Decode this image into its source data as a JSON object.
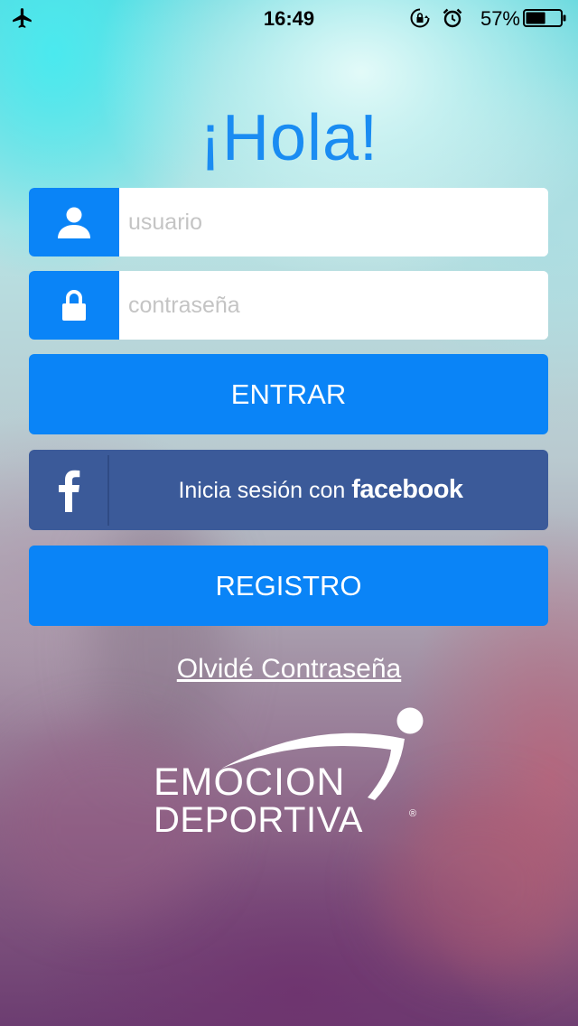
{
  "status_bar": {
    "time": "16:49",
    "battery_percent": "57%",
    "battery_level": 0.57,
    "icons": [
      "airplane-icon",
      "rotation-lock-icon",
      "alarm-icon",
      "battery-icon"
    ]
  },
  "login": {
    "title": "¡Hola!",
    "username": {
      "placeholder": "usuario",
      "value": ""
    },
    "password": {
      "placeholder": "contraseña",
      "value": ""
    },
    "enter_label": "ENTRAR",
    "facebook": {
      "prefix": "Inicia sesión con",
      "brand": "facebook"
    },
    "register_label": "REGISTRO",
    "forgot_label": "Olvidé Contraseña"
  },
  "logo": {
    "line1": "EMOCION",
    "line2": "DEPORTIVA",
    "mark": "®"
  },
  "colors": {
    "accent": "#0a84f7",
    "title": "#1a8cf2",
    "facebook": "#3b5a99",
    "text_on_buttons": "#ffffff"
  }
}
